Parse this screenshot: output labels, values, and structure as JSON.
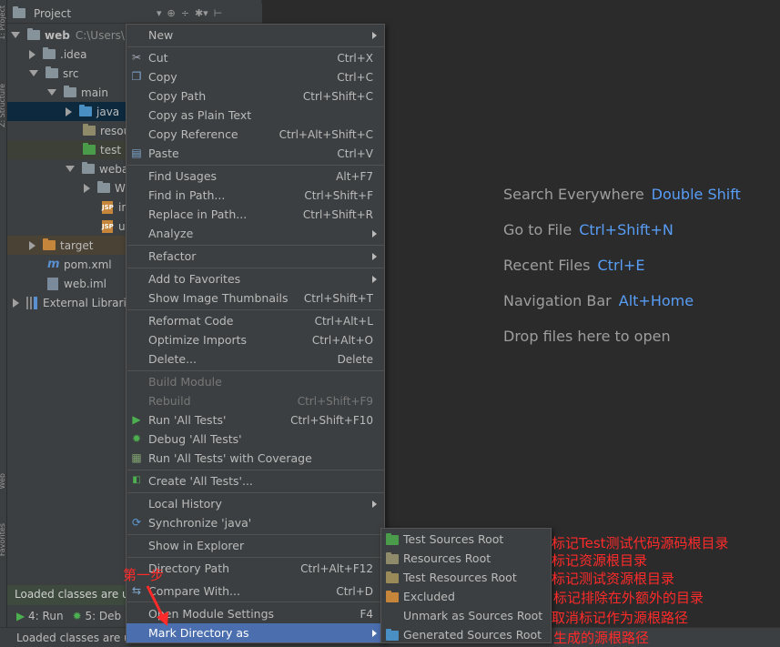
{
  "left_strip": {
    "labels": [
      "1: Project",
      "Z: Structure",
      "Web",
      "Favorites"
    ]
  },
  "project_panel": {
    "title": "Project",
    "tree": [
      {
        "label": "web",
        "path": "C:\\Users\\"
      },
      {
        "label": ".idea"
      },
      {
        "label": "src"
      },
      {
        "label": "main"
      },
      {
        "label": "java"
      },
      {
        "label": "resou"
      },
      {
        "label": "test"
      },
      {
        "label": "weba"
      },
      {
        "label": "W"
      },
      {
        "label": "in"
      },
      {
        "label": "u"
      },
      {
        "label": "target"
      },
      {
        "label": "pom.xml"
      },
      {
        "label": "web.iml"
      },
      {
        "label": "External Librari"
      }
    ],
    "file_badges": {
      "jsp": "JSP",
      "maven": "m"
    }
  },
  "tooltip": "Loaded classes are u",
  "bottom_tabs": {
    "run": "4: Run",
    "debug": "5: Deb"
  },
  "status_text": "Loaded classes are u",
  "welcome": [
    {
      "text": "Search Everywhere",
      "key": "Double Shift"
    },
    {
      "text": "Go to File",
      "key": "Ctrl+Shift+N"
    },
    {
      "text": "Recent Files",
      "key": "Ctrl+E"
    },
    {
      "text": "Navigation Bar",
      "key": "Alt+Home"
    },
    {
      "text": "Drop files here to open",
      "key": ""
    }
  ],
  "context_menu": [
    {
      "label": "New",
      "shortcut": ""
    },
    {
      "label": "Cut",
      "shortcut": "Ctrl+X"
    },
    {
      "label": "Copy",
      "shortcut": "Ctrl+C"
    },
    {
      "label": "Copy Path",
      "shortcut": "Ctrl+Shift+C"
    },
    {
      "label": "Copy as Plain Text",
      "shortcut": ""
    },
    {
      "label": "Copy Reference",
      "shortcut": "Ctrl+Alt+Shift+C"
    },
    {
      "label": "Paste",
      "shortcut": "Ctrl+V"
    },
    {
      "label": "Find Usages",
      "shortcut": "Alt+F7"
    },
    {
      "label": "Find in Path...",
      "shortcut": "Ctrl+Shift+F"
    },
    {
      "label": "Replace in Path...",
      "shortcut": "Ctrl+Shift+R"
    },
    {
      "label": "Analyze",
      "shortcut": ""
    },
    {
      "label": "Refactor",
      "shortcut": ""
    },
    {
      "label": "Add to Favorites",
      "shortcut": ""
    },
    {
      "label": "Show Image Thumbnails",
      "shortcut": "Ctrl+Shift+T"
    },
    {
      "label": "Reformat Code",
      "shortcut": "Ctrl+Alt+L"
    },
    {
      "label": "Optimize Imports",
      "shortcut": "Ctrl+Alt+O"
    },
    {
      "label": "Delete...",
      "shortcut": "Delete"
    },
    {
      "label": "Build Module",
      "shortcut": ""
    },
    {
      "label": "Rebuild",
      "shortcut": "Ctrl+Shift+F9"
    },
    {
      "label": "Run 'All Tests'",
      "shortcut": "Ctrl+Shift+F10"
    },
    {
      "label": "Debug 'All Tests'",
      "shortcut": ""
    },
    {
      "label": "Run 'All Tests' with Coverage",
      "shortcut": ""
    },
    {
      "label": "Create 'All Tests'...",
      "shortcut": ""
    },
    {
      "label": "Local History",
      "shortcut": ""
    },
    {
      "label": "Synchronize 'java'",
      "shortcut": ""
    },
    {
      "label": "Show in Explorer",
      "shortcut": ""
    },
    {
      "label": "Directory Path",
      "shortcut": "Ctrl+Alt+F12"
    },
    {
      "label": "Compare With...",
      "shortcut": "Ctrl+D"
    },
    {
      "label": "Open Module Settings",
      "shortcut": "F4"
    },
    {
      "label": "Mark Directory as",
      "shortcut": ""
    }
  ],
  "submenu": [
    {
      "label": "Test Sources Root"
    },
    {
      "label": "Resources Root"
    },
    {
      "label": "Test Resources Root"
    },
    {
      "label": "Excluded"
    },
    {
      "label": "Unmark as Sources Root"
    },
    {
      "label": "Generated Sources Root"
    }
  ],
  "annotations": {
    "step": "第一步",
    "notes": [
      "标记Test测试代码源码根目录",
      "标记资源根目录",
      "标记测试资源根目录",
      "标记排除在外额外的目录",
      "取消标记作为源根路径",
      "生成的源根路径"
    ]
  },
  "colors": {
    "accent": "#4b6eaf",
    "annotation": "#ff2a2a",
    "shortcut_key": "#589df6"
  }
}
